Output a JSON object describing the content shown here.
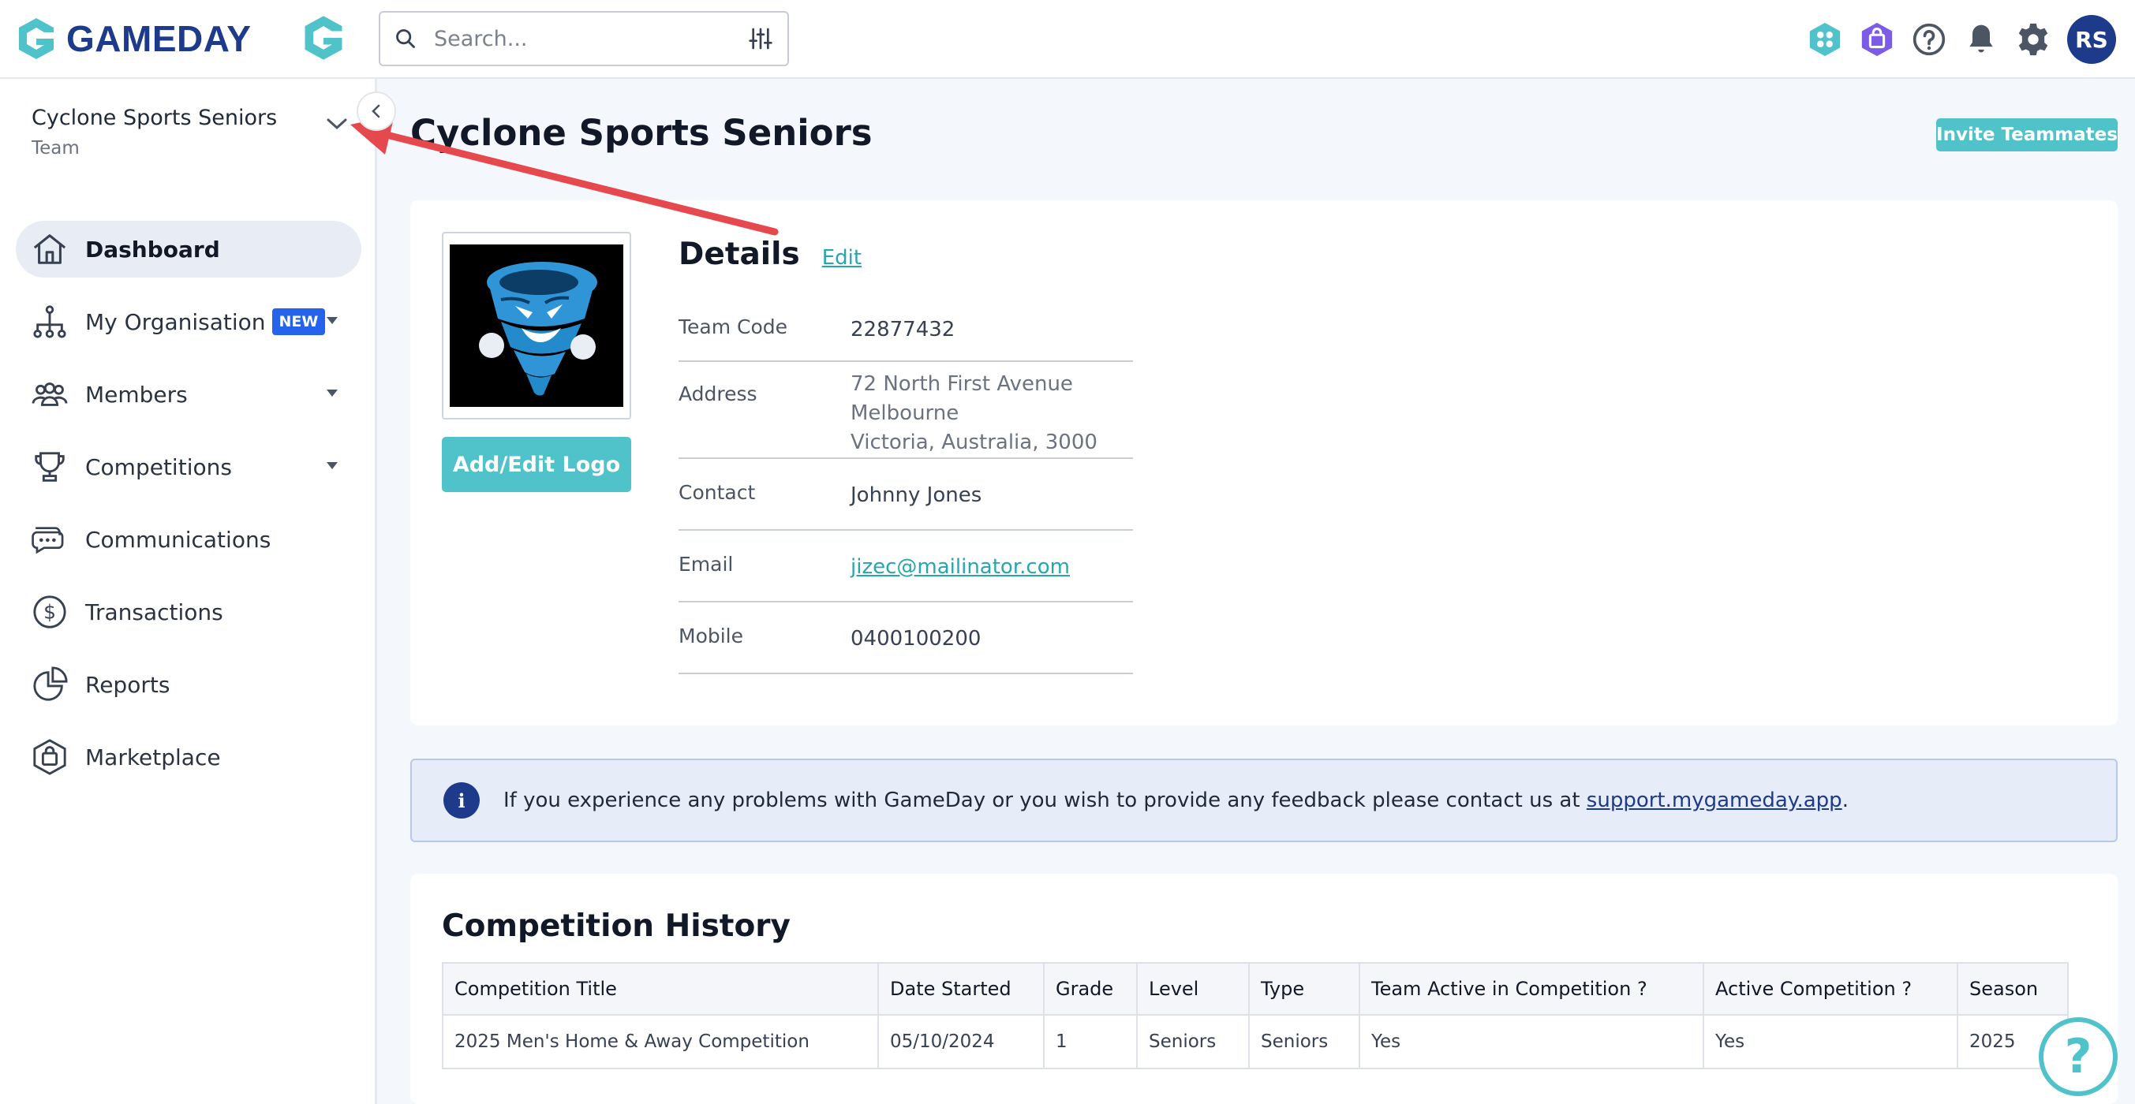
{
  "header": {
    "brand": "GAMEDAY",
    "search_placeholder": "Search...",
    "avatar_initials": "RS"
  },
  "sidebar": {
    "org_name": "Cyclone Sports Seniors",
    "org_type": "Team",
    "items": [
      {
        "label": "Dashboard"
      },
      {
        "label": "My Organisation",
        "badge": "NEW"
      },
      {
        "label": "Members"
      },
      {
        "label": "Competitions"
      },
      {
        "label": "Communications"
      },
      {
        "label": "Transactions"
      },
      {
        "label": "Reports"
      },
      {
        "label": "Marketplace"
      }
    ]
  },
  "main": {
    "title": "Cyclone Sports Seniors",
    "invite_label": "Invite Teammates",
    "logo_button": "Add/Edit Logo",
    "details": {
      "title": "Details",
      "edit_label": "Edit",
      "team_code_label": "Team Code",
      "team_code": "22877432",
      "address_label": "Address",
      "address_line1": "72 North First Avenue",
      "address_line2": "Melbourne",
      "address_line3": "Victoria,  Australia,  3000",
      "contact_label": "Contact",
      "contact": "Johnny Jones",
      "email_label": "Email",
      "email": "jizec@mailinator.com",
      "mobile_label": "Mobile",
      "mobile": "0400100200"
    },
    "info": {
      "text": "If you experience any problems with GameDay or you wish to provide any feedback please contact us at ",
      "link": "support.mygameday.app",
      "suffix": "."
    },
    "history": {
      "title": "Competition History",
      "columns": [
        "Competition Title",
        "Date Started",
        "Grade",
        "Level",
        "Type",
        "Team Active in Competition ?",
        "Active Competition ?",
        "Season"
      ],
      "rows": [
        [
          "2025 Men's Home & Away Competition",
          "05/10/2024",
          "1",
          "Seniors",
          "Seniors",
          "Yes",
          "Yes",
          "2025"
        ]
      ]
    }
  },
  "help_label": "?",
  "colors": {
    "brand_navy": "#1e3a8a",
    "accent_teal": "#4fc3c9",
    "annotation_red": "#e5484d"
  }
}
